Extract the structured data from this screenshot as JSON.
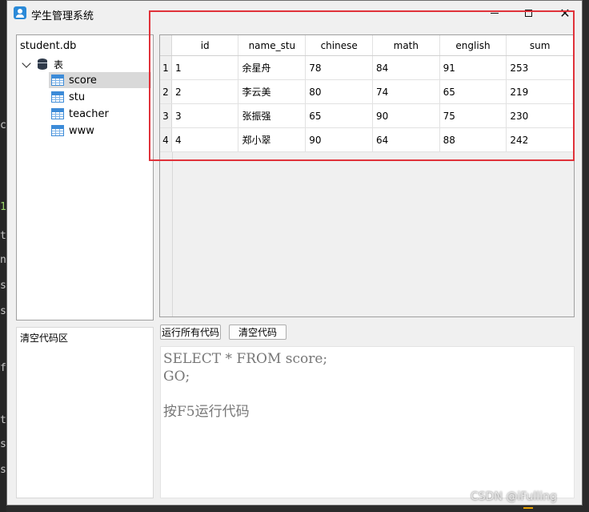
{
  "window": {
    "title": "学生管理系统"
  },
  "controls": {
    "minimize": "minimize",
    "maximize": "maximize",
    "close": "✕"
  },
  "tree": {
    "root": "student.db",
    "group": "表",
    "tables": [
      "score",
      "stu",
      "teacher",
      "www"
    ],
    "selected": "score"
  },
  "grid": {
    "columns": [
      "id",
      "name_stu",
      "chinese",
      "math",
      "english",
      "sum"
    ],
    "rows": [
      {
        "rh": "1",
        "cells": [
          "1",
          "余星舟",
          "78",
          "84",
          "91",
          "253"
        ]
      },
      {
        "rh": "2",
        "cells": [
          "2",
          "李云美",
          "80",
          "74",
          "65",
          "219"
        ]
      },
      {
        "rh": "3",
        "cells": [
          "3",
          "张振强",
          "65",
          "90",
          "75",
          "230"
        ]
      },
      {
        "rh": "4",
        "cells": [
          "4",
          "郑小翠",
          "90",
          "64",
          "88",
          "242"
        ]
      }
    ]
  },
  "code_area_label": "清空代码区",
  "buttons": {
    "run_all": "运行所有代码",
    "clear": "清空代码"
  },
  "editor": {
    "lines": [
      "SELECT * FROM score;",
      "GO;",
      "",
      "按F5运行代码"
    ]
  },
  "background_chars": [
    "c",
    "1",
    "t",
    "n",
    "s",
    "s",
    "f",
    "t",
    "s",
    "s"
  ],
  "watermark": "CSDN @iFulling",
  "colors": {
    "highlight": "#e0323a",
    "selection": "#d9d9d9",
    "icon_accent": "#2b8ad8"
  }
}
